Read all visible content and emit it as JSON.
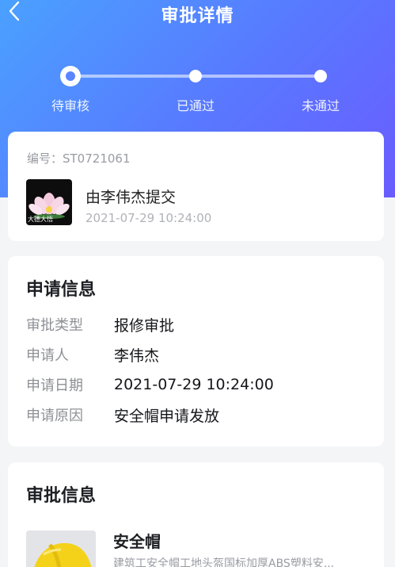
{
  "header": {
    "title": "审批详情"
  },
  "steps": [
    {
      "label": "待审核",
      "state": "current"
    },
    {
      "label": "已通过",
      "state": "pending"
    },
    {
      "label": "未通过",
      "state": "pending"
    }
  ],
  "submission": {
    "serial": "编号：ST0721061",
    "avatar_caption": "大德大悟",
    "submitter": "由李伟杰提交",
    "time": "2021-07-29 10:24:00"
  },
  "application": {
    "title": "申请信息",
    "rows": [
      {
        "label": "审批类型",
        "value": "报修审批"
      },
      {
        "label": "申请人",
        "value": "李伟杰"
      },
      {
        "label": "申请日期",
        "value": "2021-07-29 10:24:00"
      },
      {
        "label": "申请原因",
        "value": "安全帽申请发放"
      }
    ]
  },
  "approval": {
    "title": "审批信息",
    "item_name": "安全帽",
    "item_desc": "建筑工安全帽工地头盔国标加厚ABS塑料安..."
  },
  "colors": {
    "gradient_start": "#4aa1ff",
    "gradient_end": "#6a5cff",
    "step_active": "#5a85ff"
  }
}
